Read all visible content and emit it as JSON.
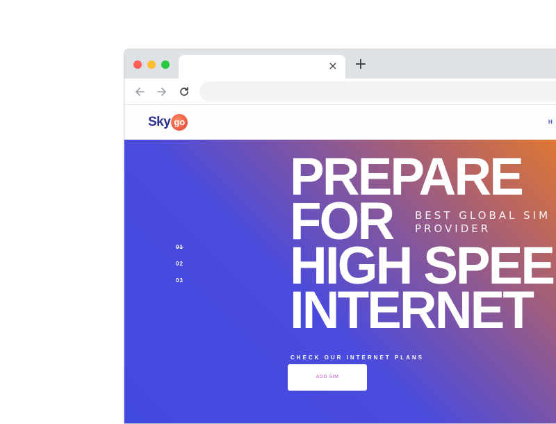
{
  "browser": {
    "tab_close_glyph": "×",
    "new_tab_glyph": "+",
    "icons": [
      "back-arrow-icon",
      "forward-arrow-icon",
      "reload-icon",
      "close-icon",
      "plus-icon"
    ]
  },
  "site": {
    "logo": {
      "sky": "Sky",
      "go": "go"
    },
    "nav_partial": "H O"
  },
  "hero": {
    "headline": [
      "PREPARE",
      "FOR",
      "HIGH SPEED",
      "INTERNET"
    ],
    "tagline": [
      "BEST GLOBAL SIM",
      "PROVIDER"
    ],
    "slides": [
      "01",
      "02",
      "03"
    ],
    "active_slide": "01",
    "cta_label": "CHECK OUR INTERNET PLANS",
    "cta_button": "ADD SIM"
  },
  "colors": {
    "gradient_start": "#4249e0",
    "gradient_end": "#e27a2e",
    "accent": "#c05ccb",
    "brand": "#2b2f8f"
  }
}
